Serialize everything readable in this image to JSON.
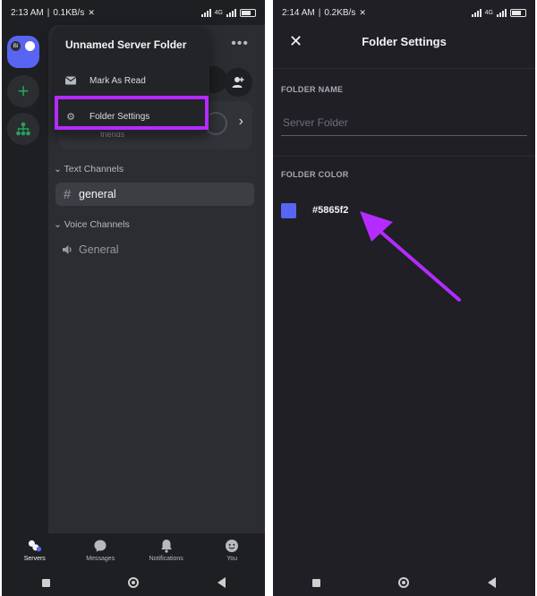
{
  "left": {
    "status": {
      "time": "2:13 AM",
      "speed": "0.1KB/s",
      "net": "4G",
      "battery": "82"
    },
    "guilds": [
      {
        "name": "server-folder",
        "badge": "Bi"
      },
      {
        "name": "add-server",
        "icon": "plus-icon"
      },
      {
        "name": "explore-servers",
        "icon": "hub-icon"
      }
    ],
    "invite_card": {
      "subtitle": "friends"
    },
    "context_menu": {
      "title": "Unnamed Server Folder",
      "items": [
        {
          "label": "Mark As Read",
          "icon": "envelope-icon"
        },
        {
          "label": "Folder Settings",
          "icon": "gear-icon"
        }
      ]
    },
    "categories": {
      "text": {
        "label": "Text Channels",
        "channels": [
          {
            "name": "general",
            "icon": "#"
          }
        ]
      },
      "voice": {
        "label": "Voice Channels",
        "channels": [
          {
            "name": "General",
            "icon": "speaker-icon"
          }
        ]
      }
    },
    "bottom_nav": [
      {
        "label": "Servers",
        "icon": "servers-icon",
        "active": true
      },
      {
        "label": "Messages",
        "icon": "chat-bubble-icon",
        "active": false
      },
      {
        "label": "Notifications",
        "icon": "bell-icon",
        "active": false
      },
      {
        "label": "You",
        "icon": "avatar-icon",
        "active": false
      }
    ],
    "highlight_color": "#b42bff"
  },
  "right": {
    "status": {
      "time": "2:14 AM",
      "speed": "0.2KB/s",
      "net": "4G",
      "battery": "82"
    },
    "header": {
      "title": "Folder Settings",
      "close_icon": "close-icon"
    },
    "folder_name": {
      "label": "FOLDER NAME",
      "placeholder": "Server Folder",
      "value": ""
    },
    "folder_color": {
      "label": "FOLDER COLOR",
      "hex": "#5865f2",
      "swatch": "#5865f2"
    },
    "arrow_color": "#b42bff"
  }
}
